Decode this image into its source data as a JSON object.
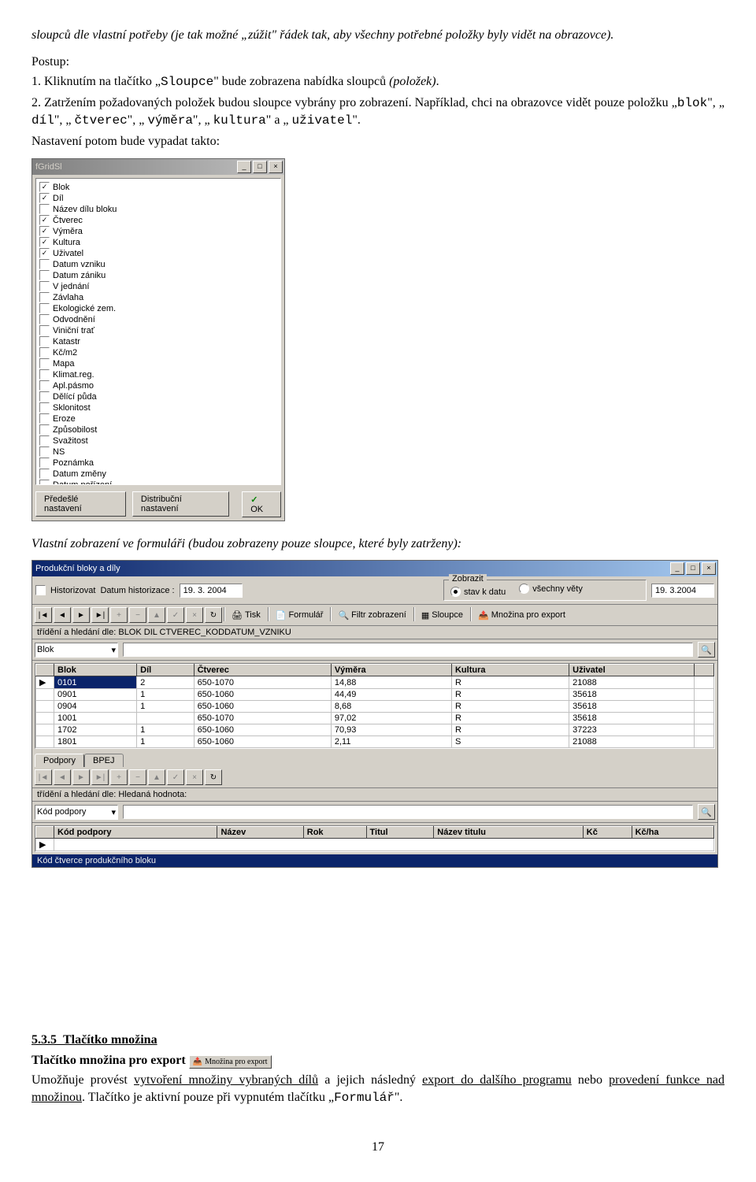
{
  "intro": {
    "para1a": "sloupců dle vlastní potřeby (je tak možné „zúžit\" řádek tak, aby všechny potřebné položky byly vidět na obrazovce).",
    "postup": "Postup:",
    "li1a": "1. Kliknutím na tlačítko „",
    "li1_mono": "Sloupce",
    "li1b": "\"  bude zobrazena nabídka sloupců ",
    "li1_it": "(položek)",
    "li1c": ".",
    "li2a": "2. Zatržením požadovaných položek budou sloupce vybrány pro zobrazení. Například, chci  na obrazovce vidět pouze položku „",
    "li2_mono1": "blok",
    "li2_q1": "\", „",
    "li2_mono2": "díl",
    "li2_q2": "\", „",
    "li2_mono3": "čtverec",
    "li2_q3": "\", „",
    "li2_mono4": "výměra",
    "li2_q4": "\", „",
    "li2_mono5": "kultura",
    "li2_q5": "\" a „",
    "li2_mono6": "uživatel",
    "li2_q6": "\".",
    "li3": "Nastavení potom bude vypadat takto:"
  },
  "fgrid": {
    "title": "fGridSl",
    "items": [
      {
        "label": "Blok",
        "checked": true
      },
      {
        "label": "Díl",
        "checked": true
      },
      {
        "label": "Název dílu bloku",
        "checked": false
      },
      {
        "label": "Čtverec",
        "checked": true
      },
      {
        "label": "Výměra",
        "checked": true
      },
      {
        "label": "Kultura",
        "checked": true
      },
      {
        "label": "Uživatel",
        "checked": true
      },
      {
        "label": "Datum vzniku",
        "checked": false
      },
      {
        "label": "Datum zániku",
        "checked": false
      },
      {
        "label": "V jednání",
        "checked": false
      },
      {
        "label": "Závlaha",
        "checked": false
      },
      {
        "label": "Ekologické zem.",
        "checked": false
      },
      {
        "label": "Odvodnění",
        "checked": false
      },
      {
        "label": "Viniční trať",
        "checked": false
      },
      {
        "label": "Katastr",
        "checked": false
      },
      {
        "label": "Kč/m2",
        "checked": false
      },
      {
        "label": "Mapa",
        "checked": false
      },
      {
        "label": "Klimat.reg.",
        "checked": false
      },
      {
        "label": "Apl.pásmo",
        "checked": false
      },
      {
        "label": "Dělící půda",
        "checked": false
      },
      {
        "label": "Sklonitost",
        "checked": false
      },
      {
        "label": "Eroze",
        "checked": false
      },
      {
        "label": "Způsobilost",
        "checked": false
      },
      {
        "label": "Svažitost",
        "checked": false
      },
      {
        "label": "NS",
        "checked": false
      },
      {
        "label": "Poznámka",
        "checked": false
      },
      {
        "label": "Datum změny",
        "checked": false
      },
      {
        "label": "Datum pořízení",
        "checked": false
      }
    ],
    "btn_prev": "Předešlé nastavení",
    "btn_dist": "Distribuční nastavení",
    "btn_ok": "OK"
  },
  "midtext": "Vlastní zobrazení ve formuláři (budou zobrazeny pouze sloupce, které byly zatrženy):",
  "mainwin": {
    "title": "Produkční bloky a díly",
    "historizovat": "Historizovat",
    "datum_hist_label": "Datum historizace :",
    "datum_hist": "19. 3. 2004",
    "group_zobrazit": "Zobrazit",
    "radio_stav": "stav k datu",
    "radio_vsechny": "všechny věty",
    "date_right": "19. 3.2004",
    "btn_tisk": "Tisk",
    "btn_formular": "Formulář",
    "btn_filtr": "Filtr zobrazení",
    "btn_sloupce": "Sloupce",
    "btn_mnozina": "Množina pro export",
    "sort_line": "třídění a hledání dle: BLOK  DIL  CTVEREC_KODDATUM_VZNIKU",
    "search_combo": "Blok",
    "search_combo2": "Kód podpory",
    "sort_line2": "třídění a hledání dle: Hledaná hodnota:",
    "headers": [
      "",
      "Blok",
      "Díl",
      "Čtverec",
      "Výměra",
      "Kultura",
      "Uživatel"
    ],
    "rows": [
      {
        "mark": "▶",
        "blok": "0101",
        "dil": "2",
        "ctv": "650-1070",
        "vym": "14,88",
        "kul": "R",
        "uziv": "21088",
        "sel": true
      },
      {
        "mark": "",
        "blok": "0901",
        "dil": "1",
        "ctv": "650-1060",
        "vym": "44,49",
        "kul": "R",
        "uziv": "35618"
      },
      {
        "mark": "",
        "blok": "0904",
        "dil": "1",
        "ctv": "650-1060",
        "vym": "8,68",
        "kul": "R",
        "uziv": "35618"
      },
      {
        "mark": "",
        "blok": "1001",
        "dil": "",
        "ctv": "650-1070",
        "vym": "97,02",
        "kul": "R",
        "uziv": "35618"
      },
      {
        "mark": "",
        "blok": "1702",
        "dil": "1",
        "ctv": "650-1060",
        "vym": "70,93",
        "kul": "R",
        "uziv": "37223"
      },
      {
        "mark": "",
        "blok": "1801",
        "dil": "1",
        "ctv": "650-1060",
        "vym": "2,11",
        "kul": "S",
        "uziv": "21088"
      }
    ],
    "tab_podpory": "Podpory",
    "tab_bpej": "BPEJ",
    "headers2": [
      "",
      "Kód podpory",
      "Název",
      "Rok",
      "Titul",
      "Název titulu",
      "Kč",
      "Kč/ha"
    ],
    "statusbar": "Kód čtverce produkčního bloku"
  },
  "section535": {
    "heading_num": "5.3.5",
    "heading_txt": "Tlačítko množina",
    "line_bold": "Tlačítko množina pro export",
    "btn_inline": "Množina pro export",
    "para_a": "Umožňuje provést ",
    "para_u1": "vytvoření množiny vybraných dílů",
    "para_b": " a jejich následný ",
    "para_u2": "export do dalšího programu",
    "para_c": " nebo ",
    "para_u3": "provedení funkce nad množinou",
    "para_d": ". Tlačítko je aktivní pouze při vypnutém tlačítku „",
    "para_mono": "Formulář",
    "para_e": "\"."
  },
  "pagenum": "17"
}
